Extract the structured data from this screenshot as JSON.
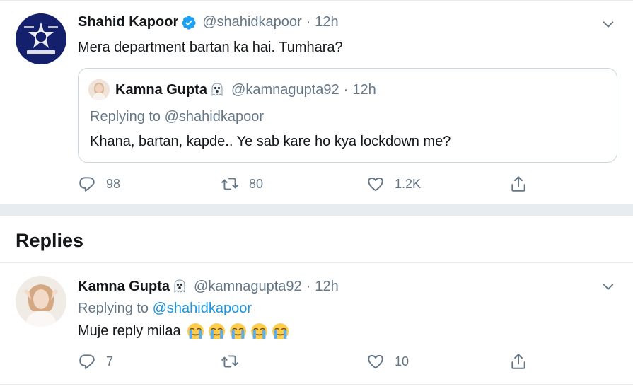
{
  "main_tweet": {
    "name": "Shahid Kapoor",
    "handle": "@shahidkapoor",
    "separator": "·",
    "time": "12h",
    "text": "Mera department bartan ka hai. Tumhara?",
    "quote": {
      "name": "Kamna Gupta",
      "handle": "@kamnagupta92",
      "separator": "·",
      "time": "12h",
      "replying": "Replying to @shahidkapoor",
      "text": "Khana, bartan, kapde.. Ye sab kare ho kya lockdown me?"
    },
    "actions": {
      "reply_count": "98",
      "retweet_count": "80",
      "like_count": "1.2K"
    }
  },
  "replies_header": "Replies",
  "reply_tweet": {
    "name": "Kamna Gupta",
    "handle": "@kamnagupta92",
    "separator": "·",
    "time": "12h",
    "replying_prefix": "Replying to",
    "replying_mention": "@shahidkapoor",
    "text": "Muje reply milaa",
    "emoji_count": 5,
    "actions": {
      "reply_count": "7",
      "like_count": "10"
    }
  },
  "colors": {
    "accent": "#1b95e0",
    "verified": "#1da1f2",
    "secondary_text": "#657786",
    "border": "#e6ecf0"
  },
  "icons": [
    "verified-badge-icon",
    "ghost-emoji-icon",
    "chevron-down-icon",
    "reply-icon",
    "retweet-icon",
    "like-icon",
    "share-icon",
    "crying-emoji-icon"
  ]
}
